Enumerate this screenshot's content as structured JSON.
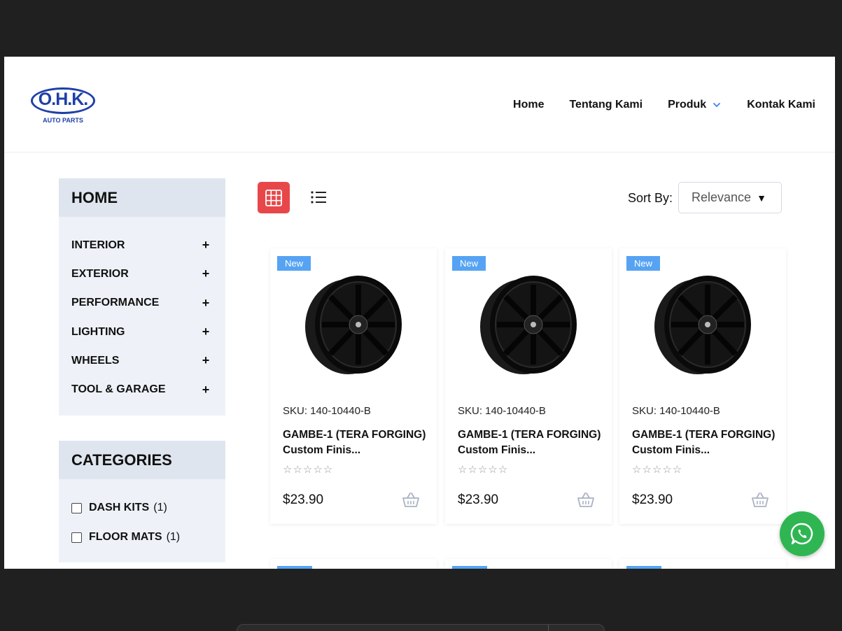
{
  "brand": {
    "logo_text": "O.H.K.",
    "logo_sub": "AUTO PARTS",
    "color": "#1d3fa8"
  },
  "nav": {
    "home": "Home",
    "about": "Tentang Kami",
    "products": "Produk",
    "contact": "Kontak Kami"
  },
  "sidebar": {
    "home_title": "HOME",
    "items": [
      {
        "label": "INTERIOR",
        "icon": "plus-icon"
      },
      {
        "label": "EXTERIOR",
        "icon": "plus-icon"
      },
      {
        "label": "PERFORMANCE",
        "icon": "plus-icon"
      },
      {
        "label": "LIGHTING",
        "icon": "plus-icon"
      },
      {
        "label": "WHEELS",
        "icon": "plus-icon"
      },
      {
        "label": "TOOL & GARAGE",
        "icon": "plus-icon"
      }
    ],
    "plus": "+",
    "categories_title": "CATEGORIES",
    "categories": [
      {
        "label": "DASH KITS",
        "count": "(1)"
      },
      {
        "label": "FLOOR MATS",
        "count": "(1)"
      }
    ]
  },
  "toolbar": {
    "grid_icon": "grid-view-icon",
    "list_icon": "list-view-icon",
    "sort_label": "Sort By:",
    "sort_value": "Relevance",
    "sort_arrow": "▼",
    "accent": "#e8474a"
  },
  "products": [
    {
      "badge": "New",
      "sku": "SKU: 140-10440-B",
      "name": "GAMBE-1 (TERA FORGING) Custom Finis...",
      "stars": "☆☆☆☆☆",
      "price": "$23.90"
    },
    {
      "badge": "New",
      "sku": "SKU: 140-10440-B",
      "name": "GAMBE-1 (TERA FORGING) Custom Finis...",
      "stars": "☆☆☆☆☆",
      "price": "$23.90"
    },
    {
      "badge": "New",
      "sku": "SKU: 140-10440-B",
      "name": "GAMBE-1 (TERA FORGING) Custom Finis...",
      "stars": "☆☆☆☆☆",
      "price": "$23.90"
    }
  ],
  "colors": {
    "badge": "#56a3f3",
    "whatsapp": "#2fb652"
  }
}
